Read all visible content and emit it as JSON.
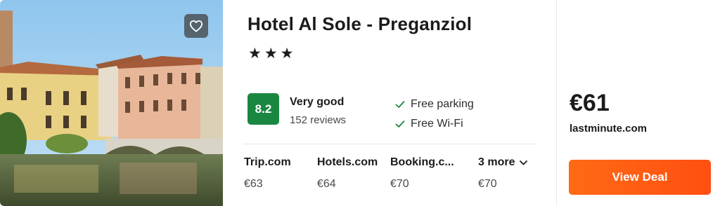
{
  "hotel": {
    "name": "Hotel Al Sole - Preganziol",
    "stars": "★★★"
  },
  "rating": {
    "score": "8.2",
    "label": "Very good",
    "reviews": "152 reviews"
  },
  "amenities": [
    {
      "label": "Free parking",
      "icon": "check-icon"
    },
    {
      "label": "Free Wi-Fi",
      "icon": "check-icon"
    }
  ],
  "providers": [
    {
      "name": "Trip.com",
      "price": "€63"
    },
    {
      "name": "Hotels.com",
      "price": "€64"
    },
    {
      "name": "Booking.c...",
      "price": "€70"
    },
    {
      "name": "3 more",
      "price": "€70"
    }
  ],
  "deal": {
    "price": "€61",
    "site": "lastminute.com",
    "button_label": "View Deal"
  },
  "icons": {
    "favorite": "heart-icon",
    "more": "chevron-down-icon",
    "amenity": "check-icon"
  },
  "colors": {
    "score_badge": "#1a8741",
    "cta": "#ff5a13",
    "check": "#1a8741"
  }
}
